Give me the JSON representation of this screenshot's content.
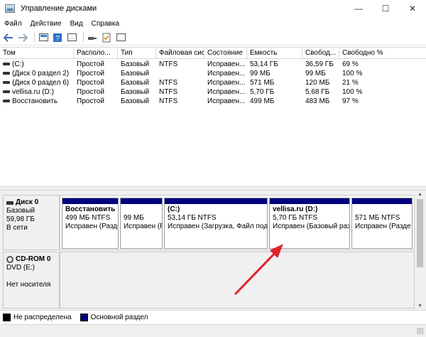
{
  "window": {
    "title": "Управление дисками",
    "minimize": "—",
    "maximize": "☐",
    "close": "✕"
  },
  "menu": [
    "Файл",
    "Действие",
    "Вид",
    "Справка"
  ],
  "table": {
    "columns": [
      "Том",
      "Располо...",
      "Тип",
      "Файловая система",
      "Состояние",
      "Емкость",
      "Свобод...",
      "Свободно %"
    ],
    "rows": [
      [
        "(C:)",
        "Простой",
        "Базовый",
        "NTFS",
        "Исправен...",
        "53,14 ГБ",
        "36,59 ГБ",
        "69 %"
      ],
      [
        "(Диск 0 раздел 2)",
        "Простой",
        "Базовый",
        "",
        "Исправен...",
        "99 МБ",
        "99 МБ",
        "100 %"
      ],
      [
        "(Диск 0 раздел 6)",
        "Простой",
        "Базовый",
        "NTFS",
        "Исправен...",
        "571 МБ",
        "120 МБ",
        "21 %"
      ],
      [
        "vellisa.ru  (D:)",
        "Простой",
        "Базовый",
        "NTFS",
        "Исправен...",
        "5,70 ГБ",
        "5,68 ГБ",
        "100 %"
      ],
      [
        "Восстановить",
        "Простой",
        "Базовый",
        "NTFS",
        "Исправен...",
        "499 МБ",
        "483 МБ",
        "97 %"
      ]
    ]
  },
  "disks": [
    {
      "name": "Диск 0",
      "type": "Базовый",
      "size": "59,98 ГБ",
      "status": "В сети",
      "partitions": [
        {
          "label": "Восстановить",
          "size": "499 МБ NTFS",
          "status": "Исправен (Разде"
        },
        {
          "label": "",
          "size": "99 МБ",
          "status": "Исправен (Р"
        },
        {
          "label": "(C:)",
          "size": "53,14 ГБ NTFS",
          "status": "Исправен (Загрузка, Файл подка"
        },
        {
          "label": "vellisa.ru  (D:)",
          "size": "5,70 ГБ NTFS",
          "status": "Исправен (Базовый раз"
        },
        {
          "label": "",
          "size": "571 МБ NTFS",
          "status": "Исправен (Разде"
        }
      ]
    },
    {
      "name": "CD-ROM 0",
      "type": "DVD (E:)",
      "size": "",
      "status": "Нет носителя"
    }
  ],
  "legend": [
    {
      "label": "Не распределена",
      "color": "#000000"
    },
    {
      "label": "Основной раздел",
      "color": "#00007f"
    }
  ],
  "colors": {
    "partition_bar": "#00007f",
    "annotation_arrow": "#e0202a"
  }
}
